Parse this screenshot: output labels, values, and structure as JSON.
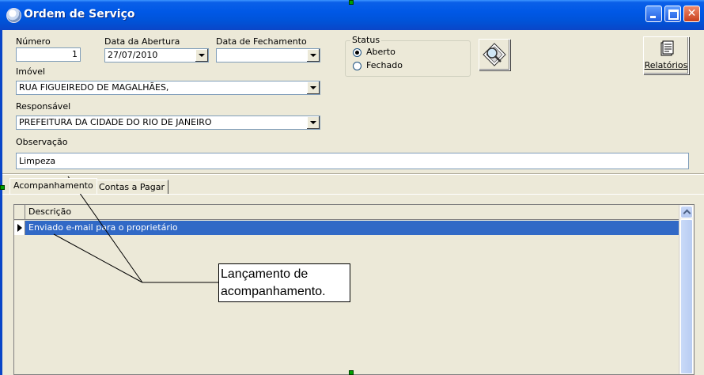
{
  "window": {
    "title": "Ordem de Serviço"
  },
  "form": {
    "numero_label": "Número",
    "numero_value": "1",
    "data_abertura_label": "Data da Abertura",
    "data_abertura_value": "27/07/2010",
    "data_fechamento_label": "Data de Fechamento",
    "data_fechamento_value": "",
    "status_label": "Status",
    "status_options": [
      "Aberto",
      "Fechado"
    ],
    "status_selected": "Aberto",
    "imovel_label": "Imóvel",
    "imovel_value": "RUA FIGUEIREDO DE MAGALHÃES,",
    "responsavel_label": "Responsável",
    "responsavel_value": "PREFEITURA DA CIDADE DO RIO DE JANEIRO",
    "observacao_label": "Observação",
    "observacao_value": "Limpeza"
  },
  "toolbar": {
    "relatorios_label": "Relatórios"
  },
  "tabs": [
    {
      "label": "Acompanhamento"
    },
    {
      "label": "Contas a Pagar"
    }
  ],
  "grid": {
    "column_header": "Descrição",
    "rows": [
      "Enviado e-mail para o proprietário"
    ]
  },
  "annotation": {
    "text_line1": "Lançamento de",
    "text_line2": "acompanhamento."
  },
  "colors": {
    "titlebar": "#0058E6",
    "selection": "#3169C6",
    "face": "#ECE9D8"
  }
}
